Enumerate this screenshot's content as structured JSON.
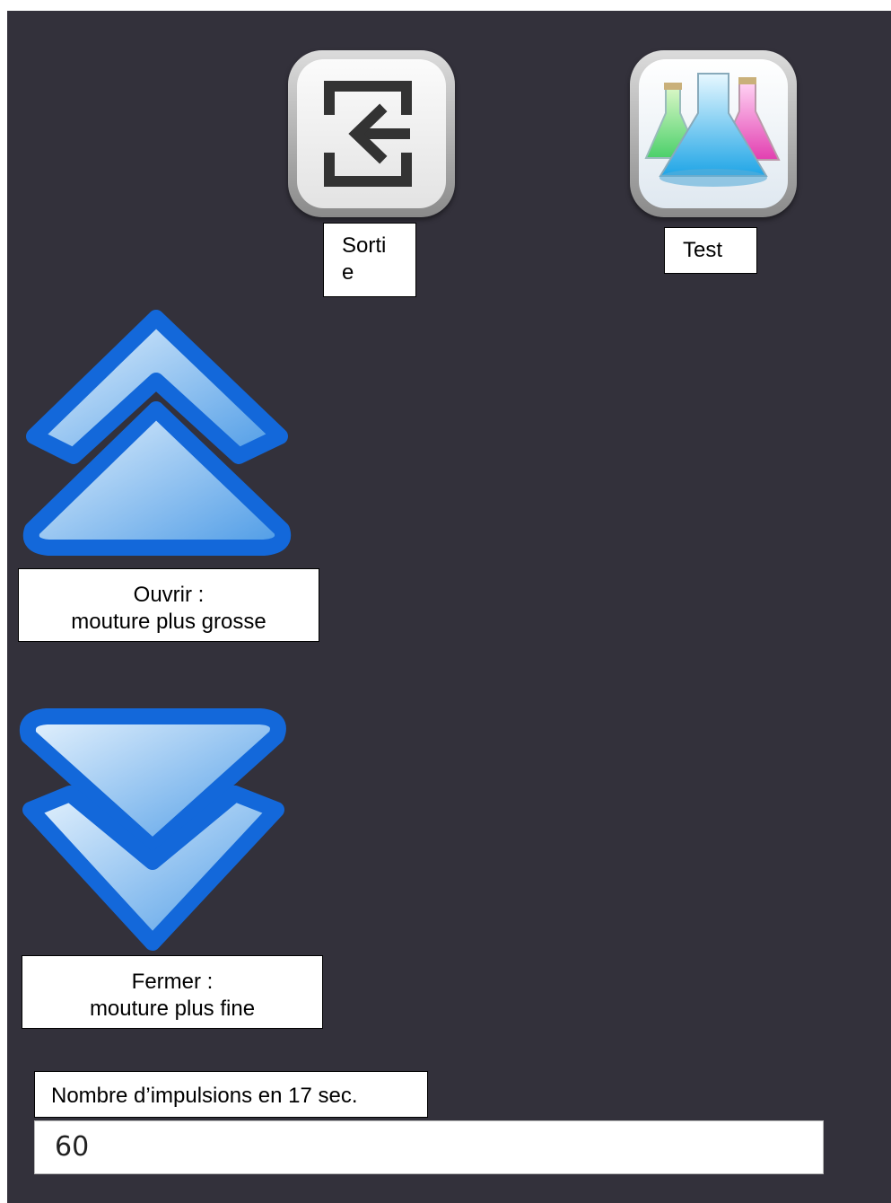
{
  "toolbar": {
    "exit": {
      "label": "Sorti\ne",
      "icon": "exit-arrow-icon"
    },
    "test": {
      "label": "Test",
      "icon": "lab-flasks-icon"
    }
  },
  "controls": {
    "open": {
      "label": "Ouvrir :\nmouture plus grosse",
      "icon": "double-chevron-up-icon"
    },
    "close": {
      "label": "Fermer :\nmouture plus fine",
      "icon": "double-chevron-down-icon"
    }
  },
  "pulses": {
    "label": "Nombre d’impulsions en 17 sec.",
    "value": "60"
  },
  "colors": {
    "background": "#33313b",
    "chevron_border": "#1565d8",
    "chevron_fill": "#a8d0f4"
  }
}
